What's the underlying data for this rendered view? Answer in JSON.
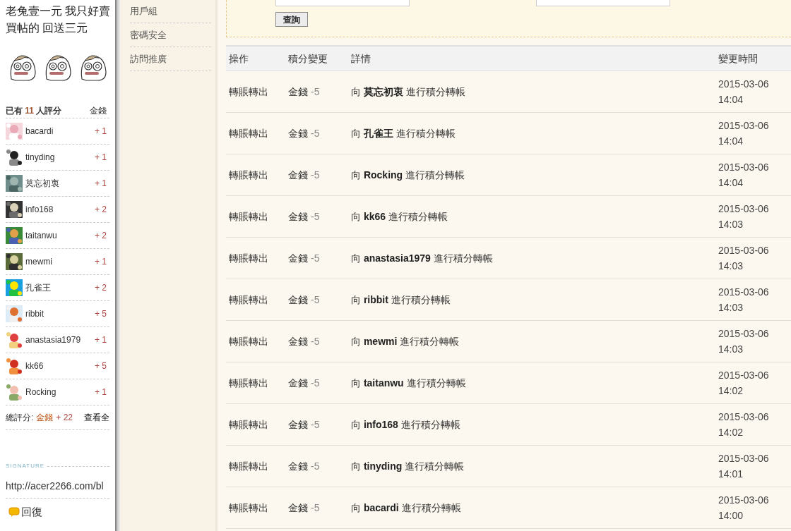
{
  "post": {
    "text_lines": [
      "老兔壹一元 我只好賣",
      "買帖的 回送三元"
    ],
    "emoticons": [
      {
        "kind": "dizzy"
      },
      {
        "kind": "dizzy"
      },
      {
        "kind": "dizzy"
      }
    ]
  },
  "ratings": {
    "heading": "已有 **11** 人評分",
    "column": "金錢",
    "rows": [
      {
        "user": "bacardi",
        "score": "+ 1"
      },
      {
        "user": "tinyding",
        "score": "+ 1"
      },
      {
        "user": "莫忘初衷",
        "score": "+ 1"
      },
      {
        "user": "info168",
        "score": "+ 2"
      },
      {
        "user": "taitanwu",
        "score": "+ 2"
      },
      {
        "user": "mewmi",
        "score": "+ 1"
      },
      {
        "user": "孔雀王",
        "score": "+ 2"
      },
      {
        "user": "ribbit",
        "score": "+ 5"
      },
      {
        "user": "anastasia1979",
        "score": "+ 1"
      },
      {
        "user": "kk66",
        "score": "+ 5"
      },
      {
        "user": "Rocking",
        "score": "+ 1"
      }
    ],
    "total_label": "總評分:",
    "total_currency": "金錢",
    "total_value": "+ 22",
    "view_all": "查看全"
  },
  "signature": {
    "label": "SIGNATURE",
    "url": "http://acer2266.com/bl"
  },
  "reply": "回復",
  "sidebar": {
    "items": [
      {
        "label": "用戶組",
        "selected": false
      },
      {
        "label": "密碼安全",
        "selected": false
      },
      {
        "label": "訪問推廣",
        "selected": false
      }
    ]
  },
  "filter": {
    "button": "查詢"
  },
  "table": {
    "columns": [
      "操作",
      "積分變更",
      "詳情",
      "變更時間"
    ],
    "rows": [
      {
        "action": "轉賬轉出",
        "currency": "金錢",
        "change": "-5",
        "detail": "向 **莫忘初衷** 進行積分轉帳",
        "time": "2015-03-06 14:04"
      },
      {
        "action": "轉賬轉出",
        "currency": "金錢",
        "change": "-5",
        "detail": "向 **孔雀王** 進行積分轉帳",
        "time": "2015-03-06 14:04"
      },
      {
        "action": "轉賬轉出",
        "currency": "金錢",
        "change": "-5",
        "detail": "向 **Rocking** 進行積分轉帳",
        "time": "2015-03-06 14:04"
      },
      {
        "action": "轉賬轉出",
        "currency": "金錢",
        "change": "-5",
        "detail": "向 **kk66** 進行積分轉帳",
        "time": "2015-03-06 14:03"
      },
      {
        "action": "轉賬轉出",
        "currency": "金錢",
        "change": "-5",
        "detail": "向 **anastasia1979** 進行積分轉帳",
        "time": "2015-03-06 14:03"
      },
      {
        "action": "轉賬轉出",
        "currency": "金錢",
        "change": "-5",
        "detail": "向 **ribbit** 進行積分轉帳",
        "time": "2015-03-06 14:03"
      },
      {
        "action": "轉賬轉出",
        "currency": "金錢",
        "change": "-5",
        "detail": "向 **mewmi** 進行積分轉帳",
        "time": "2015-03-06 14:03"
      },
      {
        "action": "轉賬轉出",
        "currency": "金錢",
        "change": "-5",
        "detail": "向 **taitanwu** 進行積分轉帳",
        "time": "2015-03-06 14:02"
      },
      {
        "action": "轉賬轉出",
        "currency": "金錢",
        "change": "-5",
        "detail": "向 **info168** 進行積分轉帳",
        "time": "2015-03-06 14:02"
      },
      {
        "action": "轉賬轉出",
        "currency": "金錢",
        "change": "-5",
        "detail": "向 **tinyding** 進行積分轉帳",
        "time": "2015-03-06 14:01"
      },
      {
        "action": "轉賬轉出",
        "currency": "金錢",
        "change": "-5",
        "detail": "向 **bacardi** 進行積分轉帳",
        "time": "2015-03-06 14:00"
      }
    ]
  }
}
